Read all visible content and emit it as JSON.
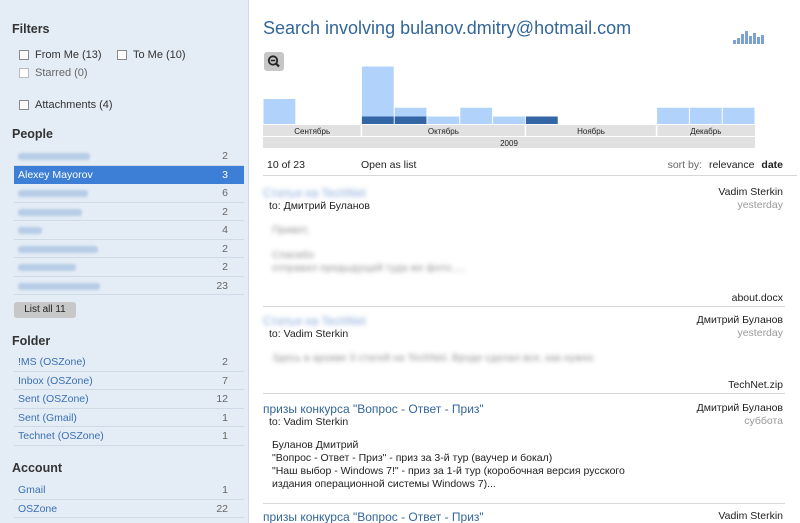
{
  "sidebar": {
    "filters_title": "Filters",
    "filters": [
      {
        "label": "From Me",
        "count": "(13)"
      },
      {
        "label": "To Me",
        "count": "(10)"
      },
      {
        "label": "Starred",
        "count": "(0)"
      },
      {
        "label": "Attachments",
        "count": "(4)"
      }
    ],
    "people_title": "People",
    "people": [
      {
        "label": "",
        "count": "2"
      },
      {
        "label": "Alexey Mayorov",
        "count": "3"
      },
      {
        "label": "",
        "count": "6"
      },
      {
        "label": "",
        "count": "2"
      },
      {
        "label": "",
        "count": "4"
      },
      {
        "label": "",
        "count": "2"
      },
      {
        "label": "",
        "count": "2"
      },
      {
        "label": "",
        "count": "23"
      }
    ],
    "list_all_label": "List all 11",
    "folder_title": "Folder",
    "folders": [
      {
        "label": "!MS (OSZone)",
        "count": "2"
      },
      {
        "label": "Inbox (OSZone)",
        "count": "7"
      },
      {
        "label": "Sent (OSZone)",
        "count": "12"
      },
      {
        "label": "Sent (Gmail)",
        "count": "1"
      },
      {
        "label": "Technet (OSZone)",
        "count": "1"
      }
    ],
    "account_title": "Account",
    "accounts": [
      {
        "label": "Gmail",
        "count": "1"
      },
      {
        "label": "OSZone",
        "count": "22"
      }
    ]
  },
  "main": {
    "title": "Search involving bulanov.dmitry@hotmail.com",
    "result_count": "10 of 23",
    "open_as_list": "Open as list",
    "sort_label": "sort by:",
    "sort_relevance": "relevance",
    "sort_date": "date",
    "messages": [
      {
        "subject": "",
        "from": "Vadim Sterkin",
        "date": "yesterday",
        "to": "to: Дмитрий Буланов",
        "body": [
          "",
          "",
          ""
        ],
        "attachment": "about.docx"
      },
      {
        "subject": "",
        "from": "Дмитрий Буланов",
        "date": "yesterday",
        "to": "to: Vadim Sterkin",
        "body": [
          ""
        ],
        "attachment": "TechNet.zip"
      },
      {
        "subject": "призы конкурса \"Вопрос - Ответ - Приз\"",
        "from": "Дмитрий Буланов",
        "date": "суббота",
        "to": "to: Vadim Sterkin",
        "body": [
          "Буланов Дмитрий",
          "\"Вопрос - Ответ - Приз\" - приз за 3-й тур (ваучер и бокал)",
          "\"Наш выбор - Windows 7!\" - приз за 1-й тур (коробочная версия русского",
          "издания операционной системы Windows 7)..."
        ],
        "attachment": ""
      },
      {
        "subject": "призы конкурса \"Вопрос - Ответ - Приз\"",
        "from": "Vadim Sterkin",
        "date": "",
        "to": "",
        "body": [],
        "attachment": ""
      }
    ]
  },
  "chart_data": {
    "type": "bar",
    "months": [
      "Сентябрь",
      "Октябрь",
      "Ноябрь",
      "Декабрь"
    ],
    "year": "2009",
    "bars": [
      {
        "total": 1.0,
        "highlight": 0
      },
      {
        "total": 0,
        "highlight": 0
      },
      {
        "total": 0,
        "highlight": 0
      },
      {
        "total": 2.3,
        "highlight": 0.3
      },
      {
        "total": 0.65,
        "highlight": 0.3
      },
      {
        "total": 0.3,
        "highlight": 0
      },
      {
        "total": 0.65,
        "highlight": 0
      },
      {
        "total": 0.3,
        "highlight": 0
      },
      {
        "total": 0.3,
        "highlight": 0.3
      },
      {
        "total": 0,
        "highlight": 0
      },
      {
        "total": 0,
        "highlight": 0
      },
      {
        "total": 0,
        "highlight": 0
      },
      {
        "total": 0.65,
        "highlight": 0
      },
      {
        "total": 0.65,
        "highlight": 0
      },
      {
        "total": 0.65,
        "highlight": 0
      }
    ],
    "colors": {
      "total": "#b0d2fb",
      "highlight": "#3465a4",
      "axis": "#e1e1e1"
    }
  }
}
